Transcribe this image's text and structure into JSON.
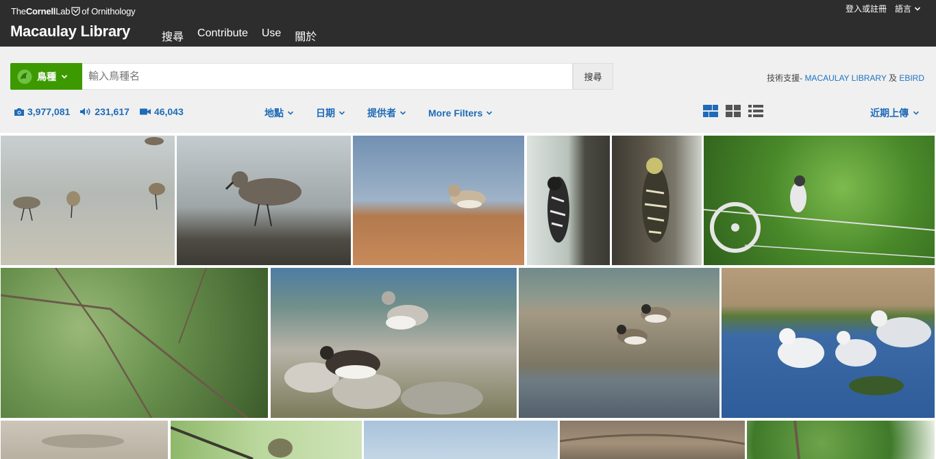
{
  "header": {
    "cornell_the": "The",
    "cornell_name": "Cornell",
    "cornell_lab": "Lab",
    "cornell_of": "of Ornithology",
    "site_title": "Macaulay Library",
    "nav": [
      "搜尋",
      "Contribute",
      "Use",
      "關於"
    ],
    "login": "登入或註冊",
    "language": "語言"
  },
  "search": {
    "taxon_label": "鳥種",
    "placeholder": "輸入鳥種名",
    "button": "搜尋",
    "powered_prefix": "技術支援-",
    "powered_macaulay": "MACAULAY LIBRARY",
    "powered_and": "及",
    "powered_ebird": "EBIRD"
  },
  "counts": {
    "photos": "3,977,081",
    "audio": "231,617",
    "video": "46,043"
  },
  "filters": [
    "地點",
    "日期",
    "提供者",
    "More Filters"
  ],
  "sort": "近期上傳",
  "colors": {
    "header_bg": "#2d2d2d",
    "accent_green": "#3c9a00",
    "link_blue": "#1e6bb8",
    "band_bg": "#f0f0f0"
  },
  "gallery": {
    "photos": [
      {
        "subject": "sandpipers-on-mudflat"
      },
      {
        "subject": "sandpiper-on-shore"
      },
      {
        "subject": "sandpiper-on-beach"
      },
      {
        "subject": "woodpecker-on-trunk"
      },
      {
        "subject": "woodpecker-on-bark"
      },
      {
        "subject": "bird-on-wire"
      },
      {
        "subject": "bird-in-tree"
      },
      {
        "subject": "turnstones-on-rocks"
      },
      {
        "subject": "plovers-on-sand"
      },
      {
        "subject": "gulls-in-water"
      },
      {
        "subject": "shore-sand"
      },
      {
        "subject": "bird-on-branch"
      },
      {
        "subject": "sky"
      },
      {
        "subject": "grassy-field"
      },
      {
        "subject": "tree-foliage"
      }
    ]
  }
}
